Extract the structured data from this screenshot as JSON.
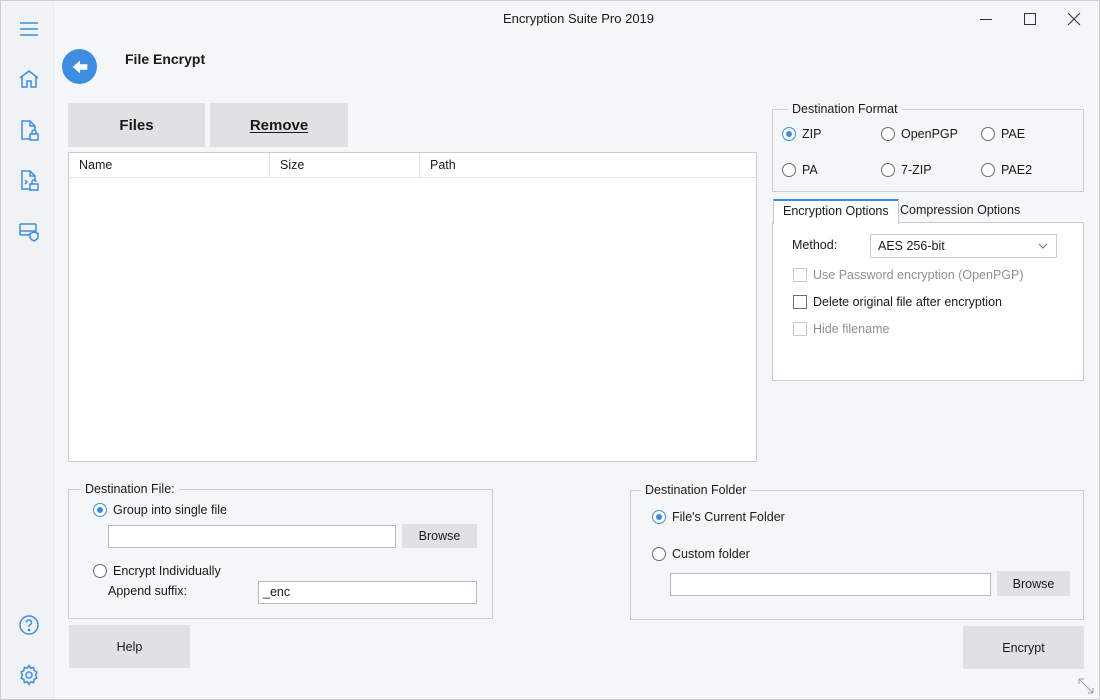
{
  "window": {
    "title": "Encryption Suite Pro 2019",
    "controls": [
      "minimize",
      "maximize",
      "close"
    ]
  },
  "rail": {
    "top_icons": [
      "menu-icon",
      "home-icon",
      "file-lock-icon",
      "file-unlock-icon",
      "shield-drive-icon"
    ],
    "bottom_icons": [
      "help-circle-icon",
      "gear-icon"
    ]
  },
  "page": {
    "title": "File Encrypt"
  },
  "toolbar": {
    "files_label": "Files",
    "remove_label": "Remove"
  },
  "file_list": {
    "columns": [
      "Name",
      "Size",
      "Path"
    ],
    "rows": []
  },
  "destination_format": {
    "legend": "Destination Format",
    "options": [
      "ZIP",
      "OpenPGP",
      "PAE",
      "PA",
      "7-ZIP",
      "PAE2"
    ],
    "selected": "ZIP"
  },
  "options_tabs": {
    "tabs": [
      "Encryption Options",
      "Compression Options"
    ],
    "active": "Encryption Options",
    "method_label": "Method:",
    "method_value": "AES 256-bit",
    "checkboxes": [
      {
        "label": "Use Password encryption (OpenPGP)",
        "checked": false,
        "enabled": false
      },
      {
        "label": "Delete original file after encryption",
        "checked": false,
        "enabled": true
      },
      {
        "label": "Hide filename",
        "checked": false,
        "enabled": false
      }
    ]
  },
  "destination_file": {
    "legend": "Destination File:",
    "group_label": "Group into single file",
    "group_path_value": "",
    "browse_label": "Browse",
    "individual_label": "Encrypt Individually",
    "suffix_label": "Append suffix:",
    "suffix_value": "_enc",
    "selected": "Group into single file"
  },
  "destination_folder": {
    "legend": "Destination Folder",
    "current_label": "File's Current Folder",
    "custom_label": "Custom folder",
    "custom_path_value": "",
    "browse_label": "Browse",
    "selected": "File's Current Folder"
  },
  "footer": {
    "help_label": "Help",
    "encrypt_label": "Encrypt"
  },
  "colors": {
    "accent": "#3d8ee0",
    "button_bg": "#dfe1e3",
    "window_bg": "#f5f6f7"
  }
}
